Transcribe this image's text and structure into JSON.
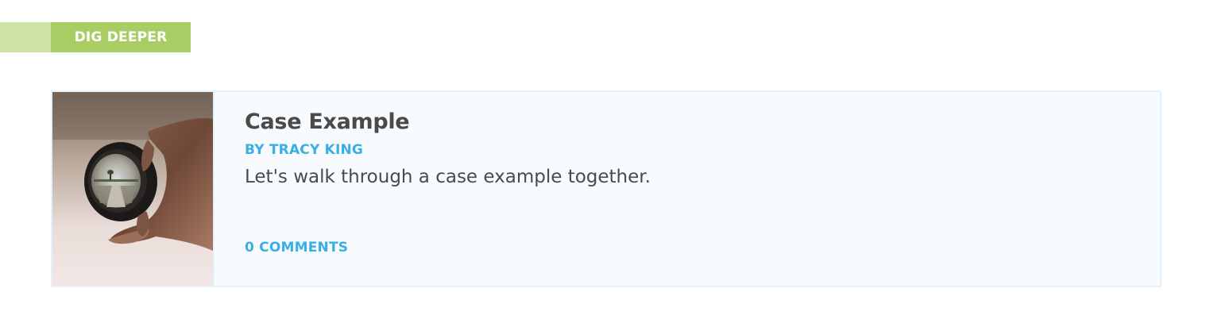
{
  "section": {
    "tag_label": "DIG DEEPER"
  },
  "card": {
    "image_name": "lens-in-hand-photo",
    "title": "Case Example",
    "author_prefix": "BY",
    "author_name": "TRACY KING",
    "author_line": "BY TRACY KING",
    "description": "Let's walk through a case example together.",
    "comments_label": "0 COMMENTS"
  },
  "colors": {
    "tag_green": "#a9cd65",
    "tag_stub_green": "#cde3a6",
    "link_blue": "#3aaee6",
    "card_bg": "#f7fbfe",
    "card_border": "#e4f1fa",
    "text_dark": "#4a4a4a"
  }
}
